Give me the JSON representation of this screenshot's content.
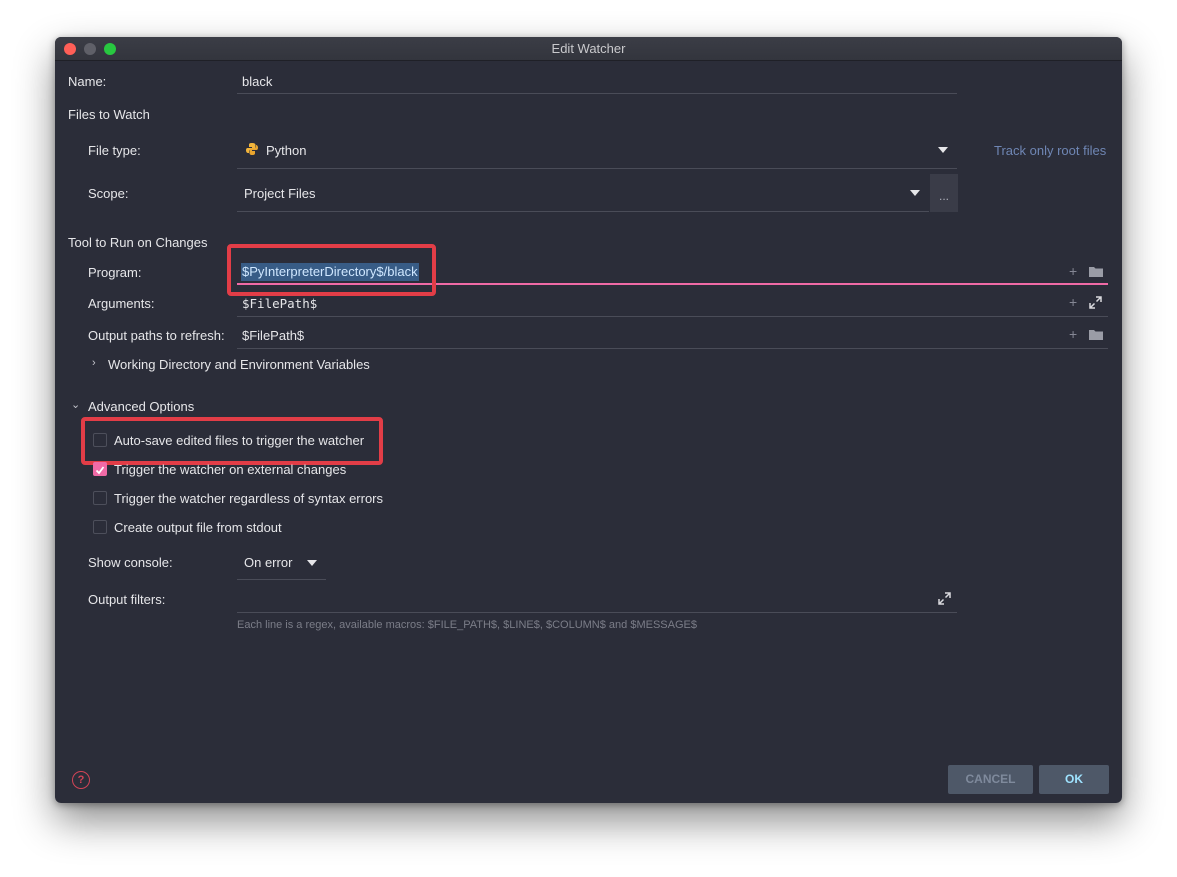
{
  "window": {
    "title": "Edit Watcher"
  },
  "name": {
    "label": "Name:",
    "value": "black"
  },
  "files_to_watch": {
    "heading": "Files to Watch",
    "file_type_label": "File type:",
    "file_type_value": "Python",
    "file_type_icon": "python-icon",
    "track_root_link": "Track only root files",
    "scope_label": "Scope:",
    "scope_value": "Project Files",
    "scope_more": "..."
  },
  "tool": {
    "heading": "Tool to Run on Changes",
    "program_label": "Program:",
    "program_value": "$PyInterpreterDirectory$/black",
    "arguments_label": "Arguments:",
    "arguments_value": "$FilePath$",
    "output_paths_label": "Output paths to refresh:",
    "output_paths_value": "$FilePath$",
    "working_dir_label": "Working Directory and Environment Variables"
  },
  "advanced": {
    "heading": "Advanced Options",
    "options": [
      {
        "label": "Auto-save edited files to trigger the watcher",
        "checked": false
      },
      {
        "label": "Trigger the watcher on external changes",
        "checked": true
      },
      {
        "label": "Trigger the watcher regardless of syntax errors",
        "checked": false
      },
      {
        "label": "Create output file from stdout",
        "checked": false
      }
    ],
    "show_console_label": "Show console:",
    "show_console_value": "On error",
    "output_filters_label": "Output filters:",
    "output_filters_hint": "Each line is a regex, available macros: $FILE_PATH$, $LINE$, $COLUMN$ and $MESSAGE$"
  },
  "footer": {
    "help": "?",
    "cancel_label": "CANCEL",
    "ok_label": "OK"
  },
  "colors": {
    "accent_pink": "#f06aa6",
    "highlight_red": "#e23d47",
    "link_blue": "#6f86b4",
    "background": "#2b2d39"
  }
}
